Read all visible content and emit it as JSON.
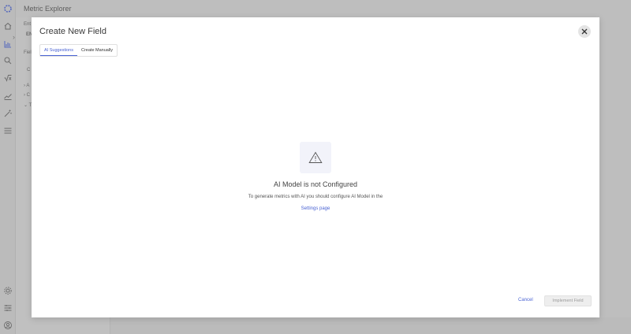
{
  "app": {
    "title": "Metric Explorer",
    "fragments": [
      "Ent",
      "EN",
      "Fiel",
      "C",
      "A",
      "C",
      "T"
    ]
  },
  "modal": {
    "title": "Create New Field",
    "tabs": [
      {
        "label": "AI Suggestions",
        "active": true
      },
      {
        "label": "Create Manually",
        "active": false
      }
    ],
    "empty_state": {
      "icon": "warning-icon",
      "title": "AI Model is not Configured",
      "description": "To generate metrics with AI you should configure AI Model in the",
      "link_label": "Settings page"
    },
    "footer": {
      "cancel_label": "Cancel",
      "implement_label": "Implement Field"
    }
  },
  "colors": {
    "accent": "#4a63d3",
    "overlay_bg": "#d6d6d6",
    "warning_bg": "#f2f3fa"
  }
}
